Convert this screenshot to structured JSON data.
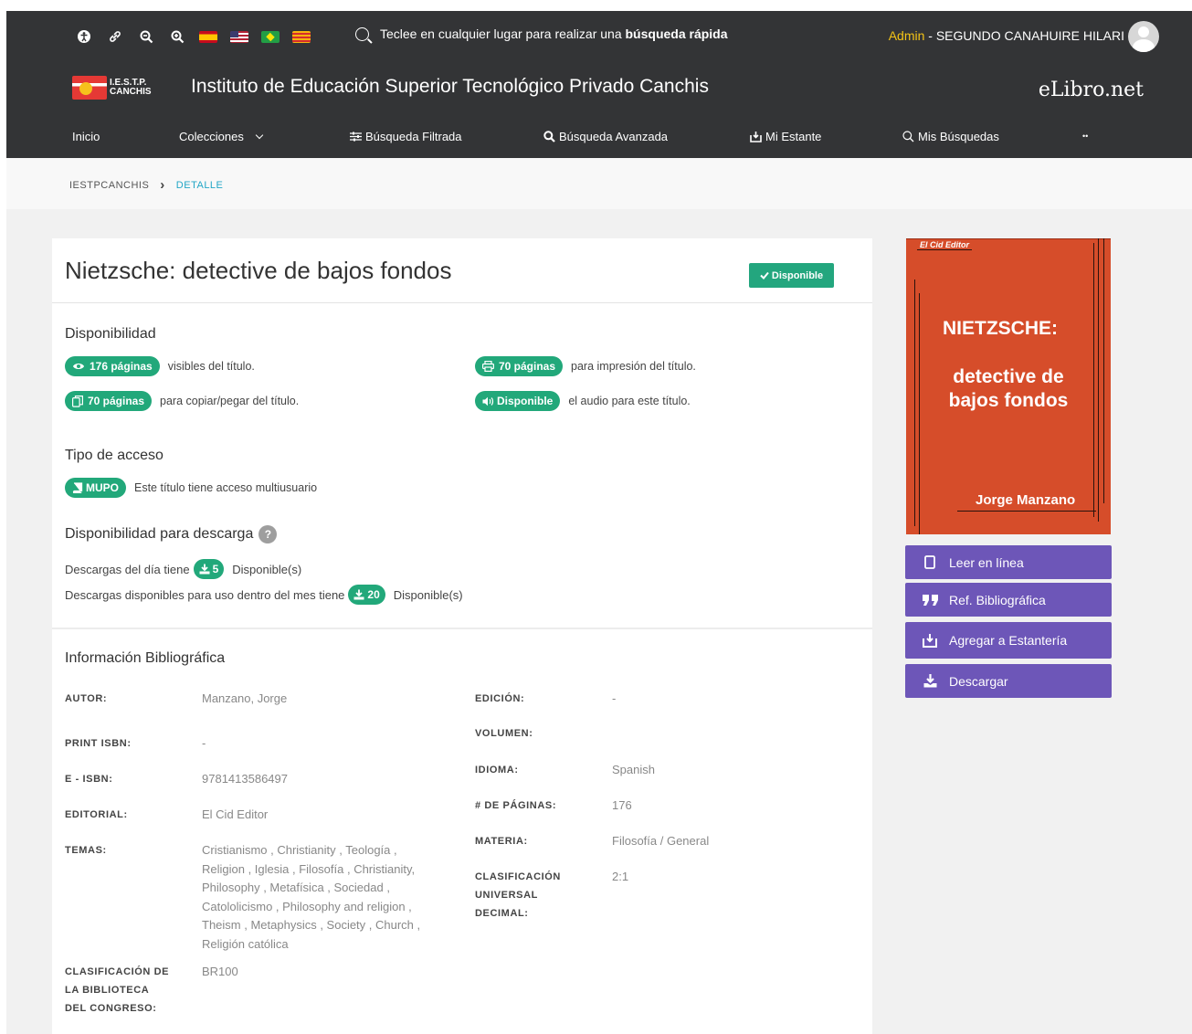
{
  "header": {
    "quick_search_prefix": "Teclee en cualquier lugar para realizar una ",
    "quick_search_bold": "búsqueda rápida",
    "user_role": "Admin",
    "user_sep": " - ",
    "user_name": "SEGUNDO CANAHUIRE HILARI",
    "institution": "Instituto de Educación Superior Tecnológico Privado Canchis",
    "logo_text_1": "I.E.S.T.P.",
    "logo_text_2": "CANCHIS",
    "brand": "eLibro.net"
  },
  "nav": {
    "inicio": "Inicio",
    "colecciones": "Colecciones",
    "filtrada": "Búsqueda Filtrada",
    "avanzada": "Búsqueda Avanzada",
    "estante": "Mi Estante",
    "busquedas": "Mis Búsquedas",
    "more": "••"
  },
  "breadcrumb": {
    "home": "IESTPCANCHIS",
    "sep": "›",
    "current": "DETALLE"
  },
  "book": {
    "title": "Nietzsche: detective de bajos fondos",
    "status_badge": "Disponible"
  },
  "availability": {
    "heading": "Disponibilidad",
    "visible_pill": "176 páginas",
    "visible_text": "visibles del título.",
    "print_pill": "70 páginas",
    "print_text": "para impresión del título.",
    "copy_pill": "70 páginas",
    "copy_text": "para copiar/pegar del título.",
    "audio_pill": "Disponible",
    "audio_text": "el audio para este título."
  },
  "access": {
    "heading": "Tipo de acceso",
    "pill": "MUPO",
    "text": "Este título tiene acceso multiusuario"
  },
  "downloads": {
    "heading": "Disponibilidad para descarga",
    "help": "?",
    "day_text": "Descargas del día tiene",
    "day_count": "5",
    "day_suffix": "Disponible(s)",
    "month_text": "Descargas disponibles para uso dentro del mes tiene",
    "month_count": "20",
    "month_suffix": "Disponible(s)"
  },
  "bib": {
    "heading": "Información Bibliográfica",
    "autor_label": "AUTOR:",
    "autor": "Manzano, Jorge",
    "print_isbn_label": "PRINT ISBN:",
    "print_isbn": "-",
    "eisbn_label": "E - ISBN:",
    "eisbn": "9781413586497",
    "editorial_label": "EDITORIAL:",
    "editorial": "El Cid Editor",
    "temas_label": "TEMAS:",
    "temas_lines": [
      "Cristianismo , Christianity , Teología ,",
      "Religion , Iglesia , Filosofía , Christianity,",
      "Philosophy , Metafísica , Sociedad ,",
      "Catololicismo , Philosophy and religion ,",
      "Theism , Metaphysics , Society , Church ,",
      "Religión católica"
    ],
    "lcc_label_lines": [
      "CLASIFICACIÓN DE",
      "LA BIBLIOTECA",
      "DEL CONGRESO:"
    ],
    "lcc": "BR100",
    "edicion_label": "EDICIÓN:",
    "edicion": "-",
    "volumen_label": "VOLUMEN:",
    "idioma_label": "IDIOMA:",
    "idioma": "Spanish",
    "paginas_label": "# DE PÁGINAS:",
    "paginas": "176",
    "materia_label": "MATERIA:",
    "materia": "Filosofía / General",
    "cdu_label_lines": [
      "CLASIFICACIÓN",
      "UNIVERSAL",
      "DECIMAL:"
    ],
    "cdu": "2:1"
  },
  "cover": {
    "editor": "El Cid Editor",
    "title_1": "NIETZSCHE:",
    "title_2": "detective de",
    "title_3": "bajos fondos",
    "author": "Jorge Manzano"
  },
  "actions": {
    "leer": "Leer en línea",
    "ref": "Ref. Bibliográfica",
    "agregar": "Agregar a Estantería",
    "descargar": "Descargar"
  },
  "colors": {
    "header_bg": "#333436",
    "accent_green": "#22a87a",
    "accent_purple": "#6d56b8",
    "link_blue": "#23a6c6",
    "role_yellow": "#f3c316",
    "cover_orange": "#d64d2a"
  }
}
